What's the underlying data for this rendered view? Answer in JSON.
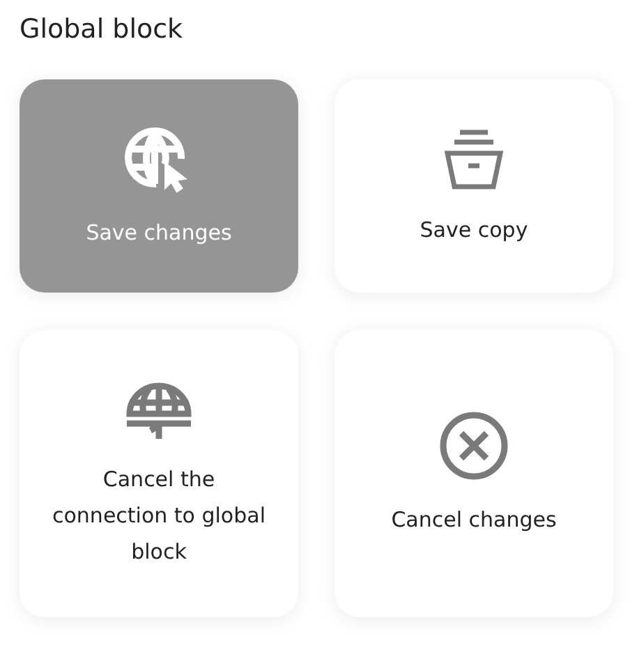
{
  "title": "Global block",
  "actions": [
    {
      "label": "Save changes",
      "kind": "globe-cursor",
      "selected": true
    },
    {
      "label": "Save copy",
      "kind": "archive",
      "selected": false
    },
    {
      "label": "Cancel the connection to global block",
      "kind": "globe-stand",
      "selected": false
    },
    {
      "label": "Cancel changes",
      "kind": "x-circle",
      "selected": false
    }
  ]
}
